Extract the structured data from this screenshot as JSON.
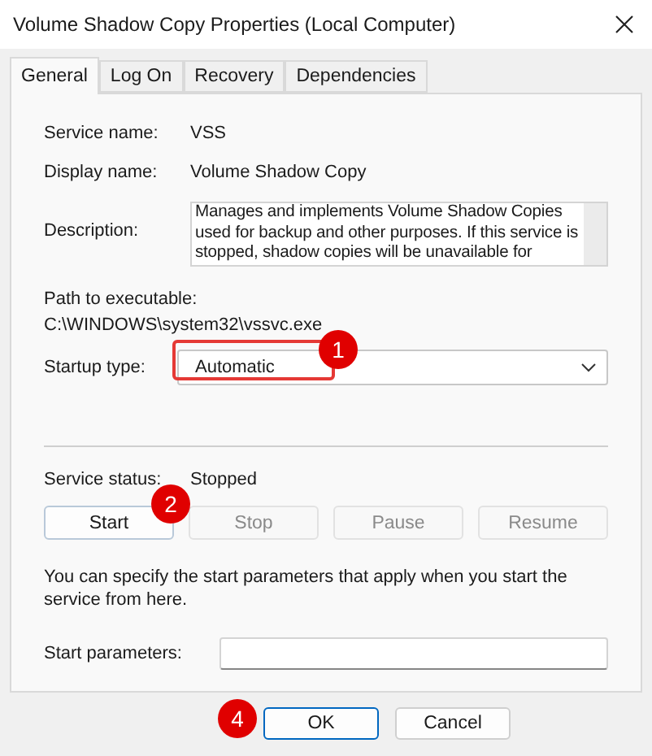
{
  "window": {
    "title": "Volume Shadow Copy Properties (Local Computer)"
  },
  "tabs": [
    {
      "label": "General",
      "selected": true
    },
    {
      "label": "Log On",
      "selected": false
    },
    {
      "label": "Recovery",
      "selected": false
    },
    {
      "label": "Dependencies",
      "selected": false
    }
  ],
  "service_name": {
    "label": "Service name:",
    "value": "VSS"
  },
  "display_name": {
    "label": "Display name:",
    "value": "Volume Shadow Copy"
  },
  "description": {
    "label": "Description:",
    "value": "Manages and implements Volume Shadow Copies used for backup and other purposes. If this service is stopped, shadow copies will be unavailable for"
  },
  "path": {
    "label": "Path to executable:",
    "value": "C:\\WINDOWS\\system32\\vssvc.exe"
  },
  "startup_type": {
    "label": "Startup type:",
    "value": "Automatic"
  },
  "service_status": {
    "label": "Service status:",
    "value": "Stopped"
  },
  "service_buttons": [
    {
      "label": "Start",
      "disabled": false
    },
    {
      "label": "Stop",
      "disabled": true
    },
    {
      "label": "Pause",
      "disabled": true
    },
    {
      "label": "Resume",
      "disabled": true
    }
  ],
  "hint": "You can specify the start parameters that apply when you start the service from here.",
  "start_parameters": {
    "label": "Start parameters:"
  },
  "dialog_buttons": [
    {
      "label": "OK",
      "default": true
    },
    {
      "label": "Cancel",
      "default": false
    }
  ],
  "callouts": [
    "1",
    "2",
    "4"
  ]
}
